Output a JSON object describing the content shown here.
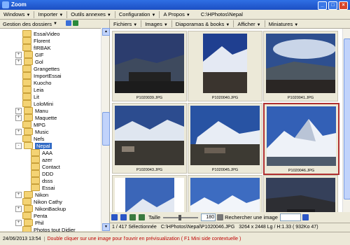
{
  "window": {
    "title": "Zoom"
  },
  "menubar": {
    "items": [
      "Windows",
      "Importer",
      "Outils annexes",
      "Configuration",
      "A Propos"
    ],
    "path": "C:\\HPhotos\\Nepal"
  },
  "left_pane": {
    "header": "Gestion des dossiers",
    "tree": [
      {
        "label": "EssaiVideo",
        "indent": 1,
        "expander": ""
      },
      {
        "label": "Florent",
        "indent": 1,
        "expander": ""
      },
      {
        "label": "fIRBAK",
        "indent": 1,
        "expander": ""
      },
      {
        "label": "GIF",
        "indent": 1,
        "expander": "+"
      },
      {
        "label": "Gol",
        "indent": 1,
        "expander": "+"
      },
      {
        "label": "Grangettes",
        "indent": 1,
        "expander": ""
      },
      {
        "label": "ImportEssai",
        "indent": 1,
        "expander": ""
      },
      {
        "label": "Kuocho",
        "indent": 1,
        "expander": ""
      },
      {
        "label": "Leia",
        "indent": 1,
        "expander": ""
      },
      {
        "label": "Lit",
        "indent": 1,
        "expander": ""
      },
      {
        "label": "LoloMini",
        "indent": 1,
        "expander": ""
      },
      {
        "label": "Manu",
        "indent": 1,
        "expander": "+"
      },
      {
        "label": "Maquette",
        "indent": 1,
        "expander": "+"
      },
      {
        "label": "MPG",
        "indent": 1,
        "expander": ""
      },
      {
        "label": "Music",
        "indent": 1,
        "expander": "+"
      },
      {
        "label": "Nefs",
        "indent": 1,
        "expander": ""
      },
      {
        "label": "Nepal",
        "indent": 1,
        "expander": "-",
        "selected": true
      },
      {
        "label": "AAA",
        "indent": 2,
        "expander": ""
      },
      {
        "label": "azer",
        "indent": 2,
        "expander": ""
      },
      {
        "label": "Contact",
        "indent": 2,
        "expander": ""
      },
      {
        "label": "DDD",
        "indent": 2,
        "expander": ""
      },
      {
        "label": "dsss",
        "indent": 2,
        "expander": ""
      },
      {
        "label": "Essai",
        "indent": 2,
        "expander": ""
      },
      {
        "label": "Nikon",
        "indent": 1,
        "expander": "+"
      },
      {
        "label": "Nikon Cathy",
        "indent": 1,
        "expander": ""
      },
      {
        "label": "NikonBackup",
        "indent": 1,
        "expander": "+"
      },
      {
        "label": "Penta",
        "indent": 1,
        "expander": ""
      },
      {
        "label": "Phil",
        "indent": 1,
        "expander": "+"
      },
      {
        "label": "Photos tout Didier",
        "indent": 1,
        "expander": ""
      }
    ]
  },
  "right_pane": {
    "menu": [
      "Fichiers",
      "Images",
      "Diaporamas & books",
      "Afficher",
      "Miniatures"
    ],
    "thumbnails": [
      {
        "caption": "P1020039.JPG",
        "scene": "village-dusk"
      },
      {
        "caption": "P1020040.JPG",
        "scene": "peak-blue-portrait"
      },
      {
        "caption": "P1020041.JPG",
        "scene": "clouds-valley"
      },
      {
        "caption": "P1020043.JPG",
        "scene": "valley-houses"
      },
      {
        "caption": "P1020045.JPG",
        "scene": "peak-village"
      },
      {
        "caption": "P1020046.JPG",
        "scene": "snow-peak",
        "selected": true
      },
      {
        "caption": "",
        "scene": "portrait-peak"
      },
      {
        "caption": "",
        "scene": "snow-range"
      },
      {
        "caption": "",
        "scene": "dark-valley"
      }
    ],
    "toolbar": {
      "size_label": "Taille",
      "zoom_value": "180",
      "search_label": "Rechercher une image"
    },
    "info": {
      "count": "1 / 417 Sélectionnée",
      "file": "C:\\HPhotos\\Nepal\\P1020046.JPG",
      "meta": "3264 x 2448  Lg / H:1.33  ( 932Ko 47)"
    }
  },
  "statusbar": {
    "date": "24/06/2013 13:54",
    "hint": "Double cliquer sur une image pour l'ouvrir en prévisualization ( F1 Mini side contextuelle )"
  }
}
